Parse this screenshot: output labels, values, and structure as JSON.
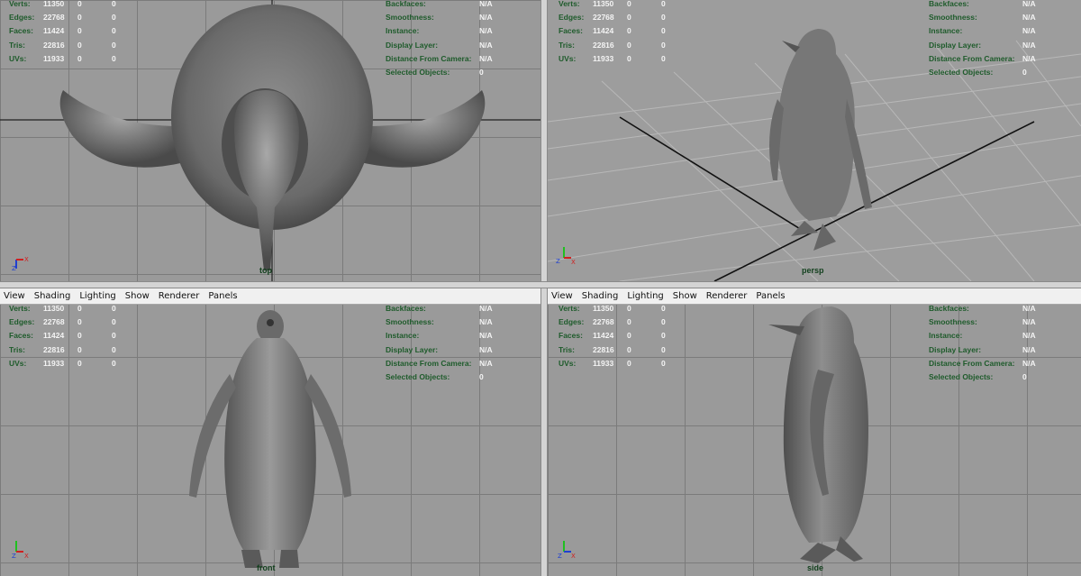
{
  "menu": [
    "View",
    "Shading",
    "Lighting",
    "Show",
    "Renderer",
    "Panels"
  ],
  "stats_left": [
    {
      "label": "Verts:",
      "value": "11350",
      "a": "0",
      "b": "0"
    },
    {
      "label": "Edges:",
      "value": "22768",
      "a": "0",
      "b": "0"
    },
    {
      "label": "Faces:",
      "value": "11424",
      "a": "0",
      "b": "0"
    },
    {
      "label": "Tris:",
      "value": "22816",
      "a": "0",
      "b": "0"
    },
    {
      "label": "UVs:",
      "value": "11933",
      "a": "0",
      "b": "0"
    }
  ],
  "stats_right": [
    {
      "label": "Backfaces:",
      "value": "N/A"
    },
    {
      "label": "Smoothness:",
      "value": "N/A"
    },
    {
      "label": "Instance:",
      "value": "N/A"
    },
    {
      "label": "Display Layer:",
      "value": "N/A"
    },
    {
      "label": "Distance From Camera:",
      "value": "N/A"
    },
    {
      "label": "Selected Objects:",
      "value": "0"
    }
  ],
  "viewports": {
    "top": {
      "camera": "top",
      "axes": [
        "Z",
        "X"
      ]
    },
    "persp": {
      "camera": "persp",
      "axes": [
        "Z",
        "X"
      ]
    },
    "front": {
      "camera": "front",
      "axes": [
        "Z",
        "X"
      ]
    },
    "side": {
      "camera": "side",
      "axes": [
        "Z",
        "X"
      ]
    }
  },
  "colors": {
    "viewport_bg": "#9a9a9a",
    "grid": "#7b7b7b",
    "hud_label": "#1e5b2b",
    "axis_x": "#d02020",
    "axis_y": "#20c020",
    "axis_z": "#2040d0"
  }
}
